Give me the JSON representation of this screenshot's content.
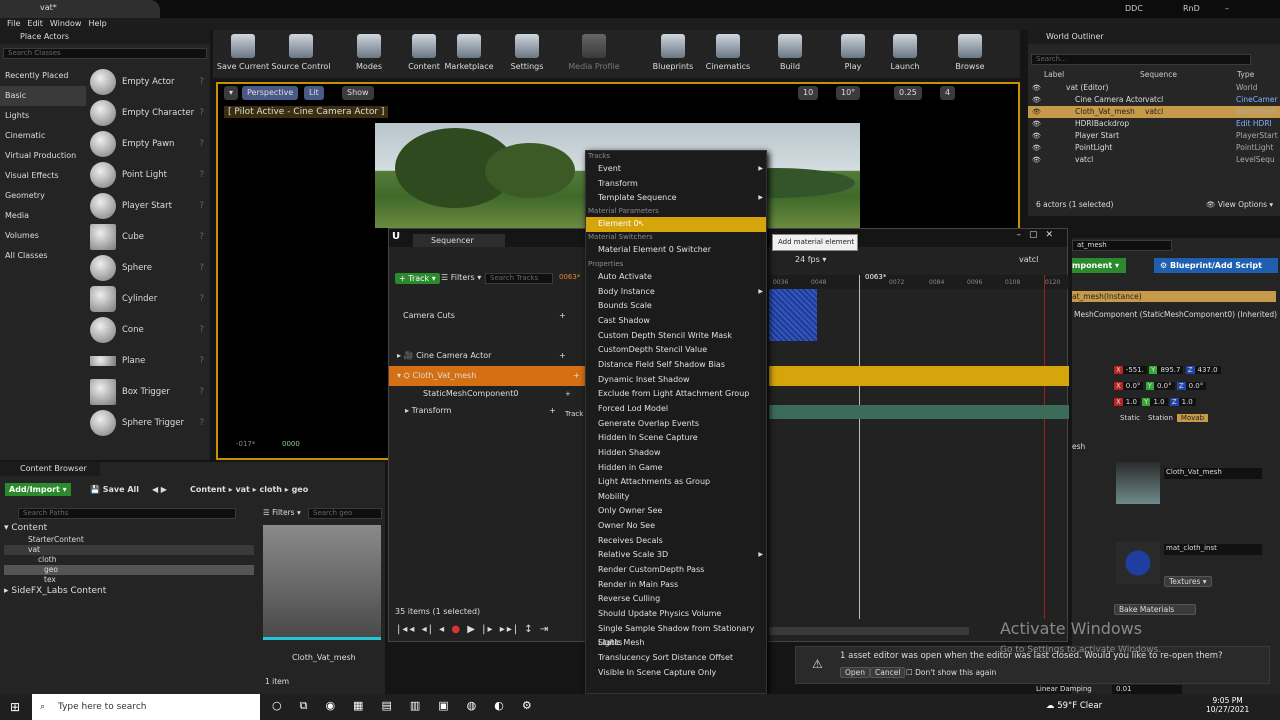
{
  "titlebar": {
    "doc_tab": "vat*",
    "ddc": "DDC",
    "rnd": "RnD"
  },
  "menu": [
    "File",
    "Edit",
    "Window",
    "Help"
  ],
  "place_actors": {
    "title": "Place Actors",
    "search_placeholder": "Search Classes",
    "categories": [
      "Recently Placed",
      "Basic",
      "Lights",
      "Cinematic",
      "Virtual Production",
      "Visual Effects",
      "Geometry",
      "Media",
      "Volumes",
      "All Classes"
    ],
    "actors": [
      "Empty Actor",
      "Empty Character",
      "Empty Pawn",
      "Point Light",
      "Player Start",
      "Cube",
      "Sphere",
      "Cylinder",
      "Cone",
      "Plane",
      "Box Trigger",
      "Sphere Trigger"
    ]
  },
  "toolbar": [
    "Save Current",
    "Source Control",
    "Modes",
    "Content",
    "Marketplace",
    "Settings",
    "Media Profile",
    "Blueprints",
    "Cinematics",
    "Build",
    "Play",
    "Launch",
    "Browse"
  ],
  "viewport": {
    "perspective": "Perspective",
    "lit": "Lit",
    "show": "Show",
    "pilot": "[ Pilot Active - Cine Camera Actor ]",
    "snap1": "10",
    "snap2": "10°",
    "snap3": "0.25",
    "snap4": "4",
    "frame_start": "-017*",
    "frame_cur": "0000"
  },
  "sequencer": {
    "tab": "Sequencer",
    "track_btn": "Track",
    "filters": "Filters",
    "search_placeholder": "Search Tracks",
    "frame": "0063*",
    "fps": "24 fps",
    "seq_name": "vatcl",
    "tick_labels": [
      "0036",
      "0048",
      "0063*",
      "0072",
      "0084",
      "0096",
      "0108",
      "0120"
    ],
    "rows": [
      "Camera Cuts",
      "Cine Camera Actor",
      "Cloth_Vat_mesh",
      "StaticMeshComponent0",
      "Transform"
    ],
    "track_small": "Track",
    "count": "35 items (1 selected)"
  },
  "context_menu": {
    "sec_tracks": "Tracks",
    "tracks": [
      "Event",
      "Transform",
      "Template Sequence"
    ],
    "sec_mat_params": "Material Parameters",
    "element": "Element 0",
    "sec_mat_switch": "Material Switchers",
    "switcher": "Material Element 0 Switcher",
    "sec_props": "Properties",
    "props": [
      "Auto Activate",
      "Body Instance",
      "Bounds Scale",
      "Cast Shadow",
      "Custom Depth Stencil Write Mask",
      "CustomDepth Stencil Value",
      "Distance Field Self Shadow Bias",
      "Dynamic Inset Shadow",
      "Exclude from Light Attachment Group",
      "Forced Lod Model",
      "Generate Overlap Events",
      "Hidden In Scene Capture",
      "Hidden Shadow",
      "Hidden in Game",
      "Light Attachments as Group",
      "Mobility",
      "Only Owner See",
      "Owner No See",
      "Receives Decals",
      "Relative Scale 3D",
      "Render CustomDepth Pass",
      "Render in Main Pass",
      "Reverse Culling",
      "Should Update Physics Volume",
      "Single Sample Shadow from Stationary Lights",
      "Static Mesh",
      "Translucency Sort Distance Offset",
      "Visible In Scene Capture Only"
    ]
  },
  "tooltip": "Add material element 0",
  "outliner": {
    "title": "World Outliner",
    "search_placeholder": "Search...",
    "col_label": "Label",
    "col_seq": "Sequence",
    "col_type": "Type",
    "rows": [
      {
        "label": "vat (Editor)",
        "seq": "",
        "type": "World"
      },
      {
        "label": "Cine Camera Actor",
        "seq": "vatcl",
        "type": "CineCamer"
      },
      {
        "label": "Cloth_Vat_mesh",
        "seq": "vatcl",
        "type": "StaticMesh"
      },
      {
        "label": "HDRIBackdrop",
        "seq": "",
        "type": "Edit HDRI"
      },
      {
        "label": "Player Start",
        "seq": "",
        "type": "PlayerStart"
      },
      {
        "label": "PointLight",
        "seq": "",
        "type": "PointLight"
      },
      {
        "label": "vatcl",
        "seq": "",
        "type": "LevelSequ"
      }
    ],
    "footer": "6 actors (1 selected)",
    "view_options": "View Options"
  },
  "details": {
    "name": "at_mesh",
    "add_component": "mponent",
    "blueprint": "Blueprint/Add Script",
    "instance": "at_mesh(Instance)",
    "component": "MeshComponent (StaticMeshComponent0) (Inherited)",
    "loc": [
      "-551.",
      "895.7",
      "437.0"
    ],
    "rot": [
      "0.0°",
      "0.0°",
      "0.0°"
    ],
    "scale": [
      "1.0",
      "1.0",
      "1.0"
    ],
    "mobility": [
      "Static",
      "Station",
      "Movab"
    ],
    "mesh_section": "esh",
    "mesh_name": "Cloth_Vat_mesh",
    "material": "mat_cloth_inst",
    "textures": "Textures",
    "bake": "Bake Materials",
    "linear_damping": "Linear Damping",
    "damping_val": "0.01"
  },
  "content_browser": {
    "title": "Content Browser",
    "add_import": "Add/Import",
    "save_all": "Save All",
    "path": [
      "Content",
      "vat",
      "cloth",
      "geo"
    ],
    "search_paths": "Search Paths",
    "filters": "Filters",
    "search_geo": "Search geo",
    "tree": [
      "Content",
      "StarterContent",
      "vat",
      "cloth",
      "geo",
      "tex",
      "SideFX_Labs Content"
    ],
    "asset": "Cloth_Vat_mesh",
    "count": "1 item"
  },
  "notification": {
    "text": "1 asset editor was open when the editor was last closed. Would you like to re-open them?",
    "open": "Open",
    "cancel": "Cancel",
    "dont_show": "Don't show this again"
  },
  "watermark": {
    "line1": "Activate Windows",
    "line2": "Go to Settings to activate Windows."
  },
  "taskbar": {
    "search": "Type here to search",
    "weather": "59°F  Clear",
    "time": "9:05 PM",
    "date": "10/27/2021"
  }
}
